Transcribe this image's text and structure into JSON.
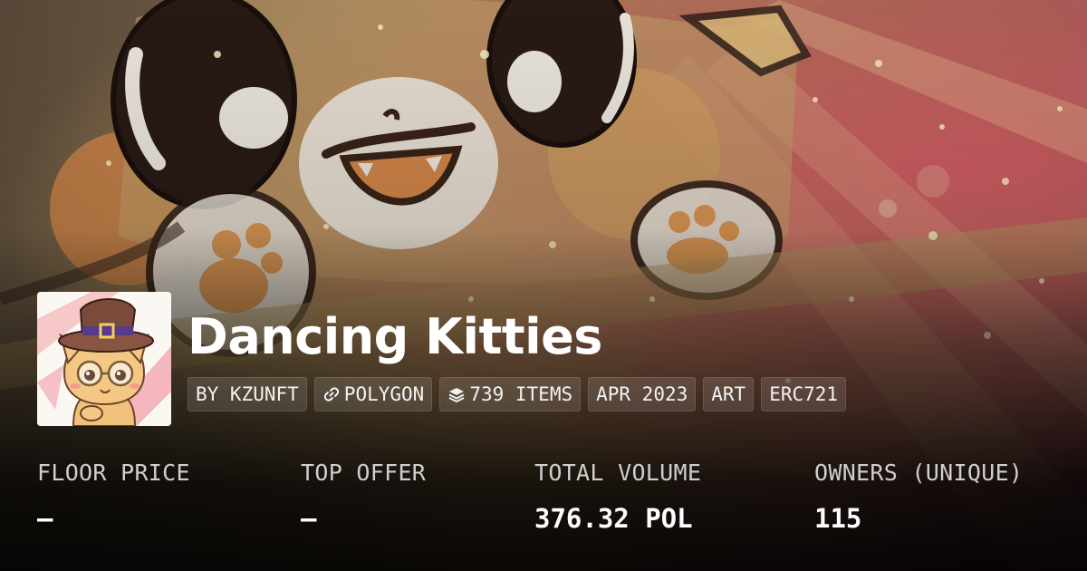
{
  "collection": {
    "name": "Dancing Kitties",
    "tags": [
      {
        "label": "BY KZUNFT",
        "icon": null
      },
      {
        "label": "POLYGON",
        "icon": "link-icon"
      },
      {
        "label": "739 ITEMS",
        "icon": "layers-icon"
      },
      {
        "label": "APR 2023",
        "icon": null
      },
      {
        "label": "ART",
        "icon": null
      },
      {
        "label": "ERC721",
        "icon": null
      }
    ]
  },
  "stats": [
    {
      "label": "FLOOR PRICE",
      "value": "–"
    },
    {
      "label": "TOP OFFER",
      "value": "–"
    },
    {
      "label": "TOTAL VOLUME",
      "value": "376.32 POL"
    },
    {
      "label": "OWNERS (UNIQUE)",
      "value": "115"
    }
  ],
  "colors": {
    "text_primary": "#ffffff",
    "text_secondary": "#cfcfcf",
    "tag_background": "rgba(255,255,255,0.12)"
  }
}
